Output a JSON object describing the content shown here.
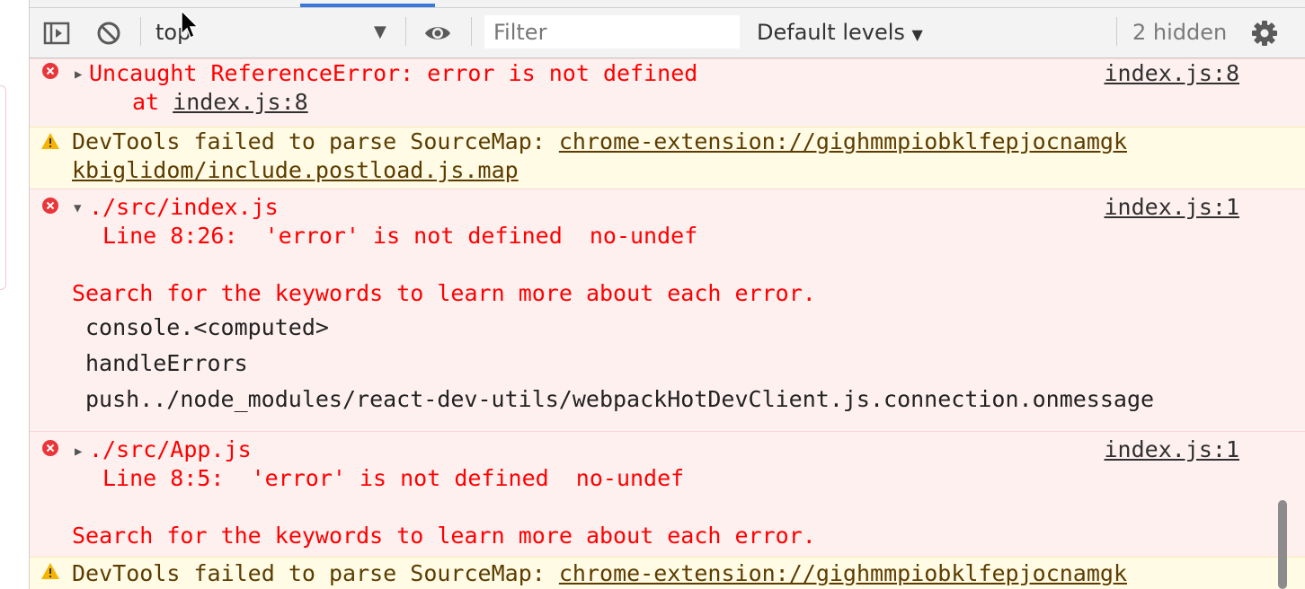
{
  "toolbar": {
    "context": "top",
    "filter_placeholder": "Filter",
    "levels": "Default levels",
    "hidden": "2 hidden"
  },
  "messages": {
    "m1": {
      "text": "Uncaught ReferenceError: error is not defined",
      "at_prefix": "at ",
      "at_link": "index.js:8",
      "source": "index.js:8"
    },
    "m2": {
      "prefix": "DevTools failed to parse SourceMap: ",
      "link1": "chrome-extension://gighmmpiobklfepjocnamgk",
      "link2": "kbiglidom/include.postload.js.map"
    },
    "m3": {
      "title": "./src/index.js",
      "source": "index.js:1",
      "line": "Line 8:26:  'error' is not defined  no-undef",
      "hint": "Search for the keywords to learn more about each error.",
      "stack": [
        "console.<computed>",
        "handleErrors",
        "push../node_modules/react-dev-utils/webpackHotDevClient.js.connection.onmessage"
      ]
    },
    "m4": {
      "title": "./src/App.js",
      "source": "index.js:1",
      "line": "Line 8:5:  'error' is not defined  no-undef",
      "hint": "Search for the keywords to learn more about each error."
    },
    "m5": {
      "prefix": "DevTools failed to parse SourceMap: ",
      "link1": "chrome-extension://gighmmpiobklfepjocnamgk"
    }
  },
  "icons": {
    "sidebar": "sidebar-toggle-icon",
    "clear": "clear-console-icon",
    "eye": "live-expression-eye-icon",
    "gear": "gear-icon",
    "error": "error-icon",
    "warning": "warning-icon"
  },
  "colors": {
    "error_text": "#ff0000",
    "error_bg": "#fff0f0",
    "warning_bg": "#fffbe5",
    "warning_text": "#5c3c00",
    "tab_accent": "#3879d9"
  }
}
